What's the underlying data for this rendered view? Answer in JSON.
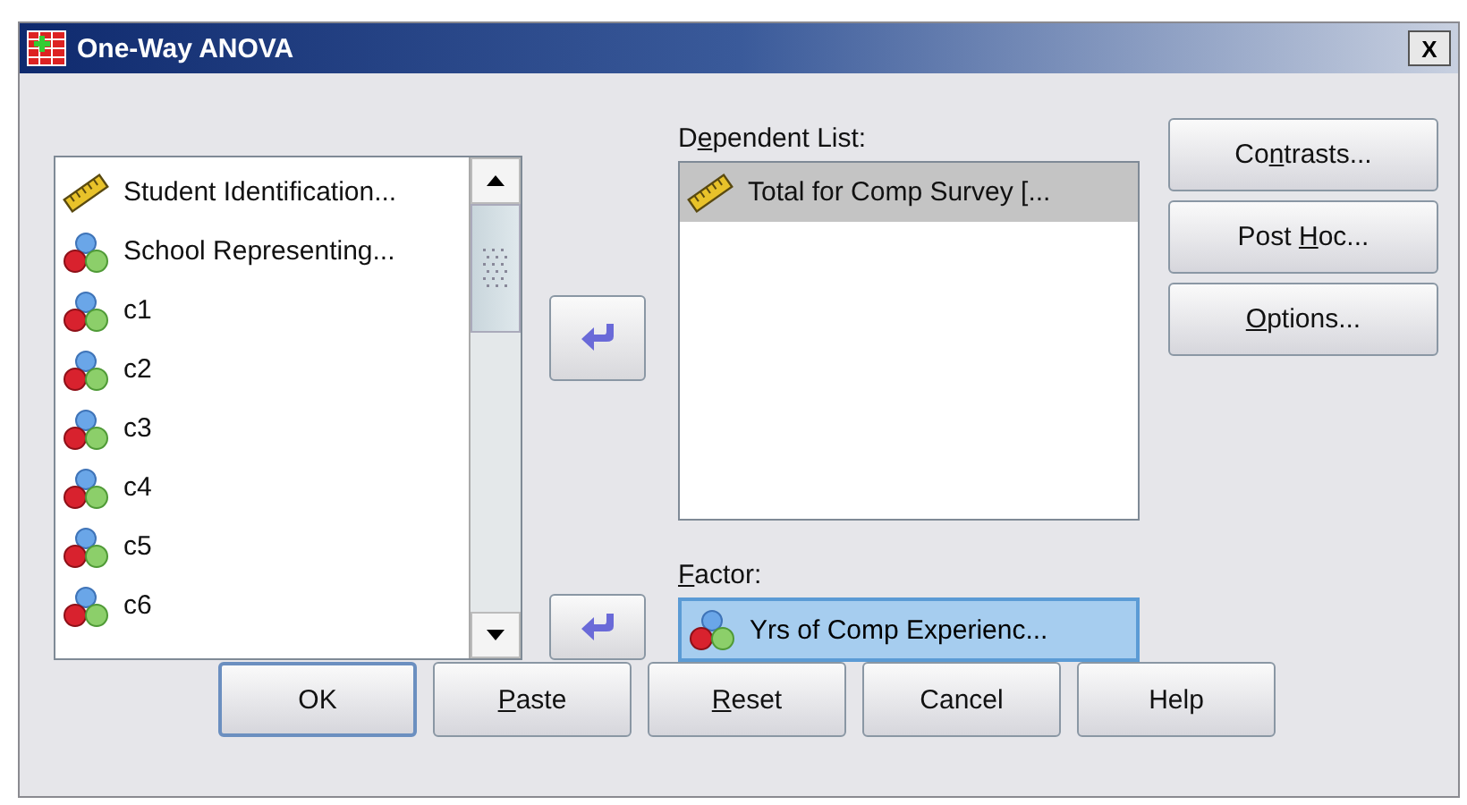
{
  "window": {
    "title": "One-Way ANOVA",
    "close": "X"
  },
  "variables": [
    {
      "name": "Student Identification...",
      "kind": "scale"
    },
    {
      "name": "School Representing...",
      "kind": "nominal"
    },
    {
      "name": "c1",
      "kind": "nominal"
    },
    {
      "name": "c2",
      "kind": "nominal"
    },
    {
      "name": "c3",
      "kind": "nominal"
    },
    {
      "name": "c4",
      "kind": "nominal"
    },
    {
      "name": "c5",
      "kind": "nominal"
    },
    {
      "name": "c6",
      "kind": "nominal"
    }
  ],
  "dependent_list": {
    "label_start": "D",
    "access_key": "e",
    "label_end": "pendent List:",
    "items": [
      {
        "name": "Total for Comp Survey [...",
        "kind": "scale",
        "selected": true
      }
    ]
  },
  "factor": {
    "access_key": "F",
    "label_end": "actor:",
    "value": {
      "name": "Yrs of Comp Experienc...",
      "kind": "nominal"
    }
  },
  "side_buttons": [
    {
      "label_start": "Co",
      "access_key": "n",
      "label_end": "trasts..."
    },
    {
      "label_start": "Post ",
      "access_key": "H",
      "label_end": "oc..."
    },
    {
      "access_key": "O",
      "label_end": "ptions..."
    }
  ],
  "buttons": [
    {
      "label_start": "OK",
      "default": true
    },
    {
      "access_key": "P",
      "label_end": "aste",
      "default": false
    },
    {
      "access_key": "R",
      "label_end": "eset",
      "default": false
    },
    {
      "label_start": "Cancel",
      "default": false
    },
    {
      "label_start": "Help",
      "default": false
    }
  ]
}
